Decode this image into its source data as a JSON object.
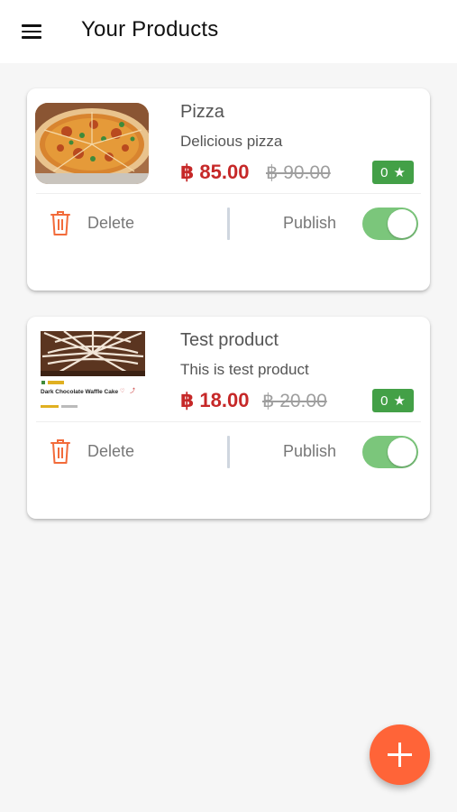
{
  "header": {
    "title": "Your Products",
    "menu_icon": "menu-icon"
  },
  "products": [
    {
      "name": "Pizza",
      "description": "Delicious pizza",
      "price": "฿ 85.00",
      "old_price": "฿ 90.00",
      "rating": "0",
      "delete_label": "Delete",
      "publish_label": "Publish",
      "published": true,
      "image": "pizza-image"
    },
    {
      "name": "Test product",
      "description": "This is test product",
      "price": "฿ 18.00",
      "old_price": "฿ 20.00",
      "rating": "0",
      "delete_label": "Delete",
      "publish_label": "Publish",
      "published": true,
      "image": "chocolate-waffle-cake-image",
      "image_caption": "Dark Chocolate Waffle Cake"
    }
  ],
  "fab": {
    "icon": "plus-icon"
  },
  "colors": {
    "price_red": "#c62828",
    "rating_green": "#43a047",
    "switch_on": "#7bc67b",
    "fab_orange": "#ff6438",
    "delete_orange": "#f26b3a"
  }
}
